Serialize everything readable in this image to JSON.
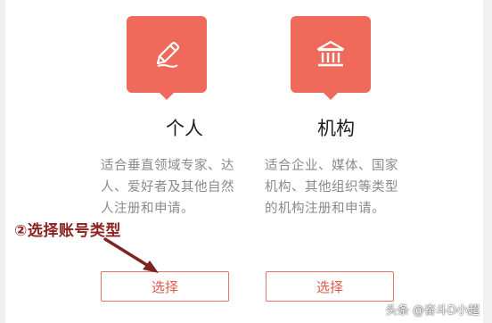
{
  "cards": [
    {
      "icon": "pencil-icon",
      "title": "个人",
      "description": "适合垂直领域专家、达人、爱好者及其他自然人注册和申请。",
      "button": "选择"
    },
    {
      "icon": "institution-icon",
      "title": "机构",
      "description": "适合企业、媒体、国家机构、其他组织等类型的机构注册和申请。",
      "button": "选择"
    }
  ],
  "annotation": "②选择账号类型",
  "watermark": "头条 @奋斗D小超",
  "colors": {
    "accent": "#ef6a5a",
    "button_text": "#e0584a",
    "annotation": "#8b2320"
  }
}
